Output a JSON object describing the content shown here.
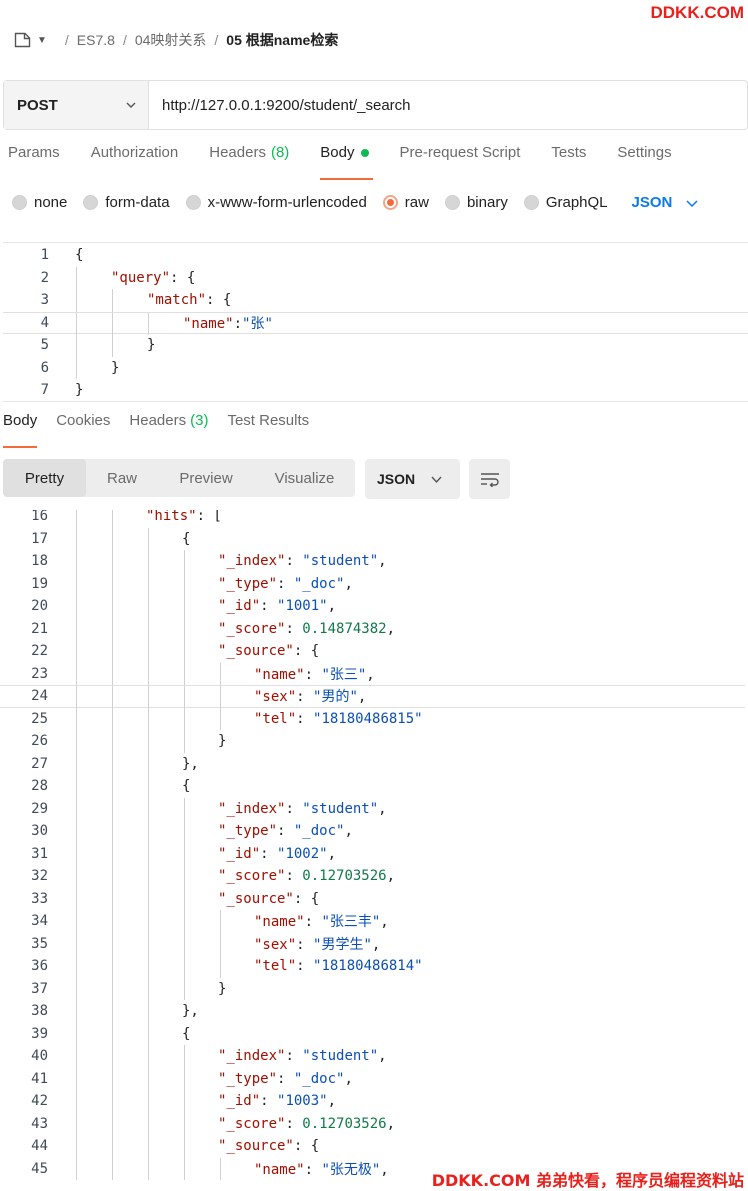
{
  "watermark": {
    "top": "DDKK.COM",
    "bottom": "DDKK.COM 弟弟快看，程序员编程资料站"
  },
  "breadcrumb": {
    "items": [
      "ES7.8",
      "04映射关系",
      "05 根据name检索"
    ],
    "separator": "/"
  },
  "request": {
    "method": "POST",
    "url": "http://127.0.0.1:9200/student/_search"
  },
  "request_tabs": [
    {
      "label": "Params"
    },
    {
      "label": "Authorization"
    },
    {
      "label": "Headers",
      "count": "(8)"
    },
    {
      "label": "Body",
      "active": true
    },
    {
      "label": "Pre-request Script"
    },
    {
      "label": "Tests"
    },
    {
      "label": "Settings"
    }
  ],
  "body_types": [
    "none",
    "form-data",
    "x-www-form-urlencoded",
    "raw",
    "binary",
    "GraphQL"
  ],
  "body_type_selected": "raw",
  "body_language": "JSON",
  "request_body_lines": [
    {
      "n": "1",
      "indent": 0,
      "parts": [
        [
          "p",
          "{"
        ]
      ]
    },
    {
      "n": "2",
      "indent": 1,
      "parts": [
        [
          "k",
          "\"query\""
        ],
        [
          "p",
          ":"
        ],
        [
          "p",
          " {"
        ]
      ]
    },
    {
      "n": "3",
      "indent": 2,
      "parts": [
        [
          "k",
          "\"match\""
        ],
        [
          "p",
          ": "
        ],
        [
          "p",
          "{"
        ]
      ]
    },
    {
      "n": "4",
      "indent": 3,
      "parts": [
        [
          "k",
          "\"name\""
        ],
        [
          "p",
          ":"
        ],
        [
          "s",
          "\"张\""
        ]
      ]
    },
    {
      "n": "5",
      "indent": 2,
      "parts": [
        [
          "p",
          "}"
        ]
      ]
    },
    {
      "n": "6",
      "indent": 1,
      "parts": [
        [
          "p",
          "}"
        ]
      ]
    },
    {
      "n": "7",
      "indent": 0,
      "parts": [
        [
          "p",
          "}"
        ]
      ]
    }
  ],
  "response_tabs": [
    {
      "label": "Body",
      "active": true
    },
    {
      "label": "Cookies"
    },
    {
      "label": "Headers",
      "count": "(3)"
    },
    {
      "label": "Test Results"
    }
  ],
  "view_modes": [
    "Pretty",
    "Raw",
    "Preview",
    "Visualize"
  ],
  "view_mode_selected": "Pretty",
  "response_format": "JSON",
  "response_lines": [
    {
      "n": "16",
      "indent": 2,
      "parts": [
        [
          "k",
          "\"hits\""
        ],
        [
          "p",
          ": ["
        ]
      ]
    },
    {
      "n": "17",
      "indent": 3,
      "parts": [
        [
          "p",
          "{"
        ]
      ]
    },
    {
      "n": "18",
      "indent": 4,
      "parts": [
        [
          "k",
          "\"_index\""
        ],
        [
          "p",
          ": "
        ],
        [
          "s",
          "\"student\""
        ],
        [
          "p",
          ","
        ]
      ]
    },
    {
      "n": "19",
      "indent": 4,
      "parts": [
        [
          "k",
          "\"_type\""
        ],
        [
          "p",
          ": "
        ],
        [
          "s",
          "\"_doc\""
        ],
        [
          "p",
          ","
        ]
      ]
    },
    {
      "n": "20",
      "indent": 4,
      "parts": [
        [
          "k",
          "\"_id\""
        ],
        [
          "p",
          ": "
        ],
        [
          "s",
          "\"1001\""
        ],
        [
          "p",
          ","
        ]
      ]
    },
    {
      "n": "21",
      "indent": 4,
      "parts": [
        [
          "k",
          "\"_score\""
        ],
        [
          "p",
          ": "
        ],
        [
          "d",
          "0.14874382"
        ],
        [
          "p",
          ","
        ]
      ]
    },
    {
      "n": "22",
      "indent": 4,
      "parts": [
        [
          "k",
          "\"_source\""
        ],
        [
          "p",
          ": "
        ],
        [
          "p",
          "{"
        ]
      ]
    },
    {
      "n": "23",
      "indent": 5,
      "parts": [
        [
          "k",
          "\"name\""
        ],
        [
          "p",
          ": "
        ],
        [
          "s",
          "\"张三\""
        ],
        [
          "p",
          ","
        ]
      ]
    },
    {
      "n": "24",
      "indent": 5,
      "parts": [
        [
          "k",
          "\"sex\""
        ],
        [
          "p",
          ": "
        ],
        [
          "s",
          "\"男的\""
        ],
        [
          "p",
          ","
        ]
      ]
    },
    {
      "n": "25",
      "indent": 5,
      "parts": [
        [
          "k",
          "\"tel\""
        ],
        [
          "p",
          ": "
        ],
        [
          "s",
          "\"18180486815\""
        ]
      ]
    },
    {
      "n": "26",
      "indent": 4,
      "parts": [
        [
          "p",
          "}"
        ]
      ]
    },
    {
      "n": "27",
      "indent": 3,
      "parts": [
        [
          "p",
          "},"
        ]
      ]
    },
    {
      "n": "28",
      "indent": 3,
      "parts": [
        [
          "p",
          "{"
        ]
      ]
    },
    {
      "n": "29",
      "indent": 4,
      "parts": [
        [
          "k",
          "\"_index\""
        ],
        [
          "p",
          ": "
        ],
        [
          "s",
          "\"student\""
        ],
        [
          "p",
          ","
        ]
      ]
    },
    {
      "n": "30",
      "indent": 4,
      "parts": [
        [
          "k",
          "\"_type\""
        ],
        [
          "p",
          ": "
        ],
        [
          "s",
          "\"_doc\""
        ],
        [
          "p",
          ","
        ]
      ]
    },
    {
      "n": "31",
      "indent": 4,
      "parts": [
        [
          "k",
          "\"_id\""
        ],
        [
          "p",
          ": "
        ],
        [
          "s",
          "\"1002\""
        ],
        [
          "p",
          ","
        ]
      ]
    },
    {
      "n": "32",
      "indent": 4,
      "parts": [
        [
          "k",
          "\"_score\""
        ],
        [
          "p",
          ": "
        ],
        [
          "d",
          "0.12703526"
        ],
        [
          "p",
          ","
        ]
      ]
    },
    {
      "n": "33",
      "indent": 4,
      "parts": [
        [
          "k",
          "\"_source\""
        ],
        [
          "p",
          ": "
        ],
        [
          "p",
          "{"
        ]
      ]
    },
    {
      "n": "34",
      "indent": 5,
      "parts": [
        [
          "k",
          "\"name\""
        ],
        [
          "p",
          ": "
        ],
        [
          "s",
          "\"张三丰\""
        ],
        [
          "p",
          ","
        ]
      ]
    },
    {
      "n": "35",
      "indent": 5,
      "parts": [
        [
          "k",
          "\"sex\""
        ],
        [
          "p",
          ": "
        ],
        [
          "s",
          "\"男学生\""
        ],
        [
          "p",
          ","
        ]
      ]
    },
    {
      "n": "36",
      "indent": 5,
      "parts": [
        [
          "k",
          "\"tel\""
        ],
        [
          "p",
          ": "
        ],
        [
          "s",
          "\"18180486814\""
        ]
      ]
    },
    {
      "n": "37",
      "indent": 4,
      "parts": [
        [
          "p",
          "}"
        ]
      ]
    },
    {
      "n": "38",
      "indent": 3,
      "parts": [
        [
          "p",
          "},"
        ]
      ]
    },
    {
      "n": "39",
      "indent": 3,
      "parts": [
        [
          "p",
          "{"
        ]
      ]
    },
    {
      "n": "40",
      "indent": 4,
      "parts": [
        [
          "k",
          "\"_index\""
        ],
        [
          "p",
          ": "
        ],
        [
          "s",
          "\"student\""
        ],
        [
          "p",
          ","
        ]
      ]
    },
    {
      "n": "41",
      "indent": 4,
      "parts": [
        [
          "k",
          "\"_type\""
        ],
        [
          "p",
          ": "
        ],
        [
          "s",
          "\"_doc\""
        ],
        [
          "p",
          ","
        ]
      ]
    },
    {
      "n": "42",
      "indent": 4,
      "parts": [
        [
          "k",
          "\"_id\""
        ],
        [
          "p",
          ": "
        ],
        [
          "s",
          "\"1003\""
        ],
        [
          "p",
          ","
        ]
      ]
    },
    {
      "n": "43",
      "indent": 4,
      "parts": [
        [
          "k",
          "\"_score\""
        ],
        [
          "p",
          ": "
        ],
        [
          "d",
          "0.12703526"
        ],
        [
          "p",
          ","
        ]
      ]
    },
    {
      "n": "44",
      "indent": 4,
      "parts": [
        [
          "k",
          "\"_source\""
        ],
        [
          "p",
          ": "
        ],
        [
          "p",
          "{"
        ]
      ]
    },
    {
      "n": "45",
      "indent": 5,
      "parts": [
        [
          "k",
          "\"name\""
        ],
        [
          "p",
          ": "
        ],
        [
          "s",
          "\"张无极\""
        ],
        [
          "p",
          ","
        ]
      ]
    }
  ]
}
